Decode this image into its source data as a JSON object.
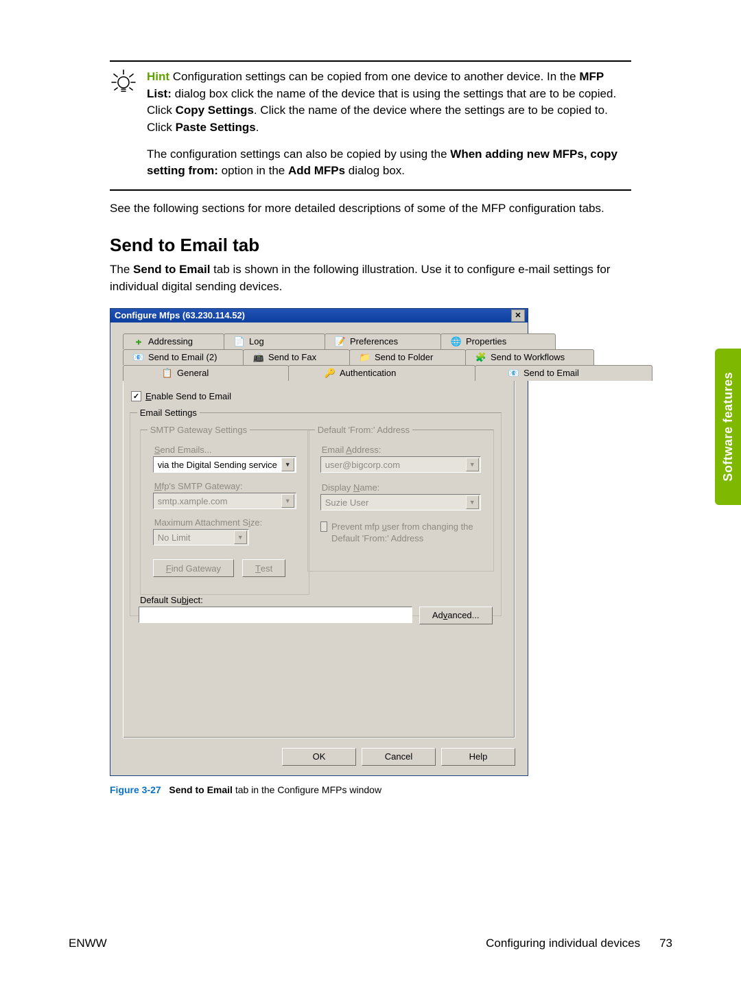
{
  "hint": {
    "label": "Hint",
    "paragraph1_html": "Configuration settings can be copied from one device to another device. In the <span class='bold'>MFP List:</span> dialog box click the name of the device that is using the settings that are to be copied. Click <span class='bold'>Copy Settings</span>. Click the name of the device where the settings are to be copied to. Click <span class='bold'>Paste Settings</span>.",
    "paragraph2_html": "The configuration settings can also be copied by using the <span class='bold'>When adding new MFPs, copy setting from:</span> option in the <span class='bold'>Add MFPs</span> dialog box."
  },
  "after_hint": "See the following sections for more detailed descriptions of some of the MFP configuration tabs.",
  "section_heading": "Send to Email tab",
  "section_intro_html": "The <span class='bold'>Send to Email</span> tab is shown in the following illustration. Use it to configure e-mail settings for individual digital sending devices.",
  "dialog": {
    "title": "Configure Mfps (63.230.114.52)",
    "tabs": {
      "addressing": "Addressing",
      "log": "Log",
      "preferences": "Preferences",
      "properties": "Properties",
      "send_to_email2": "Send to Email (2)",
      "send_to_fax": "Send to Fax",
      "send_to_folder": "Send to Folder",
      "send_to_workflows": "Send to Workflows",
      "general": "General",
      "authentication": "Authentication",
      "send_to_email": "Send to Email"
    },
    "enable_label": "Enable Send to Email",
    "email_settings_legend": "Email Settings",
    "smtp_legend": "SMTP Gateway Settings",
    "send_emails_label": "Send Emails...",
    "send_emails_value": "via the Digital Sending service",
    "gateway_label": "Mfp's SMTP Gateway:",
    "gateway_value": "smtp.xample.com",
    "max_attach_label": "Maximum Attachment Size:",
    "max_attach_value": "No Limit",
    "find_gateway_btn": "Find Gateway",
    "test_btn": "Test",
    "from_legend": "Default 'From:' Address",
    "email_addr_label": "Email Address:",
    "email_addr_value": "user@bigcorp.com",
    "display_name_label": "Display Name:",
    "display_name_value": "Suzie User",
    "prevent_label": "Prevent mfp user from changing the Default 'From:' Address",
    "default_subject_label": "Default Subject:",
    "default_subject_value": "",
    "advanced_btn": "Advanced...",
    "ok_btn": "OK",
    "cancel_btn": "Cancel",
    "help_btn": "Help"
  },
  "caption": {
    "figure": "Figure 3-27",
    "rest_html": "<span class='bold'>Send to Email</span> tab in the Configure MFPs window"
  },
  "sidetab": "Software features",
  "footer": {
    "left": "ENWW",
    "section": "Configuring individual devices",
    "page": "73"
  }
}
